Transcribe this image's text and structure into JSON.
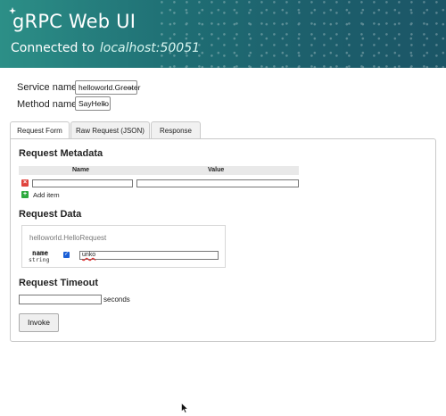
{
  "header": {
    "app_title": "gRPC  Web UI",
    "connected_label": "Connected to",
    "host": "localhost:50051"
  },
  "service": {
    "label": "Service name:",
    "selected": "helloworld.Greeter"
  },
  "method": {
    "label": "Method name:",
    "selected": "SayHello"
  },
  "tabs": [
    {
      "label": "Request Form",
      "active": true
    },
    {
      "label": "Raw Request (JSON)",
      "active": false
    },
    {
      "label": "Response",
      "active": false
    }
  ],
  "metadata": {
    "title": "Request Metadata",
    "col_name": "Name",
    "col_value": "Value",
    "remove_glyph": "×",
    "add_glyph": "+",
    "add_label": "Add item"
  },
  "request_data": {
    "title": "Request Data",
    "message_type": "helloworld.HelloRequest",
    "field": {
      "name": "name",
      "type": "string",
      "checked": true,
      "value": "unko"
    }
  },
  "timeout": {
    "title": "Request Timeout",
    "value": "",
    "unit_label": "seconds"
  },
  "invoke_label": "Invoke",
  "icons": {
    "remove": "remove-icon",
    "add": "add-icon",
    "cursor": "mouse-cursor-icon"
  },
  "colors": {
    "header_teal": "#1f6e74",
    "remove_red": "#e0443e",
    "add_green": "#2eaa3e",
    "checkbox_blue": "#1a5fd6"
  }
}
